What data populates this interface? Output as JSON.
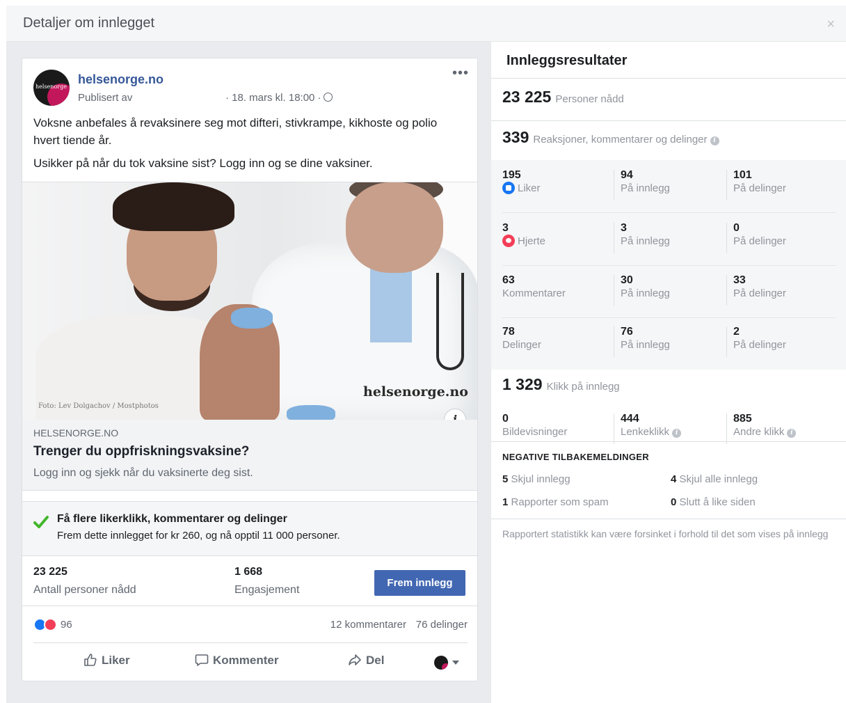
{
  "dialog": {
    "title": "Detaljer om innlegget",
    "close": "×"
  },
  "post": {
    "page_name": "helsenorge.no",
    "avatar_text": "helsenorge",
    "published_by": "Publisert av",
    "date": "· 18. mars kl. 18:00 ·",
    "more": "•••",
    "text_1": "Voksne anbefales å revaksinere seg mot difteri, stivkrampe, kikhoste og polio hvert tiende år.",
    "text_2": "Usikker på når du tok vaksine sist? Logg inn og se dine vaksiner.",
    "image": {
      "credit": "Foto: Lev Dolgachov / Mostphotos",
      "logo": "helsenorge.no",
      "info": "i"
    },
    "link": {
      "domain": "HELSENORGE.NO",
      "title": "Trenger du oppfriskningsvaksine?",
      "description": "Logg inn og sjekk når du vaksinerte deg sist."
    },
    "boost": {
      "title": "Få flere likerklikk, kommentarer og delinger",
      "subtitle": "Frem dette innlegget for kr 260, og nå opptil 11 000 personer."
    },
    "metrics": {
      "reached_value": "23 225",
      "reached_label": "Antall personer nådd",
      "engagement_value": "1 668",
      "engagement_label": "Engasjement",
      "boost_button": "Frem innlegg"
    },
    "reactions": {
      "count": "96",
      "comments": "12 kommentarer",
      "shares": "76 delinger"
    },
    "actions": {
      "like": "Liker",
      "comment": "Kommenter",
      "share": "Del"
    }
  },
  "results": {
    "title": "Innleggsresultater",
    "reach": {
      "value": "23 225",
      "label": "Personer nådd"
    },
    "engagement": {
      "value": "339",
      "label": "Reaksjoner, kommentarer og delinger"
    },
    "rows": [
      {
        "total": "195",
        "label": "Liker",
        "icon": "like-icon",
        "on_post": "94",
        "on_post_label": "På innlegg",
        "on_shares": "101",
        "on_shares_label": "På delinger"
      },
      {
        "total": "3",
        "label": "Hjerte",
        "icon": "heart-icon",
        "on_post": "3",
        "on_post_label": "På innlegg",
        "on_shares": "0",
        "on_shares_label": "På delinger"
      },
      {
        "total": "63",
        "label": "Kommentarer",
        "icon": "",
        "on_post": "30",
        "on_post_label": "På innlegg",
        "on_shares": "33",
        "on_shares_label": "På delinger"
      },
      {
        "total": "78",
        "label": "Delinger",
        "icon": "",
        "on_post": "76",
        "on_post_label": "På innlegg",
        "on_shares": "2",
        "on_shares_label": "På delinger"
      }
    ],
    "clicks": {
      "value": "1 329",
      "label": "Klikk på innlegg",
      "photo_views": "0",
      "photo_views_label": "Bildevisninger",
      "link_clicks": "444",
      "link_clicks_label": "Lenkeklikk",
      "other_clicks": "885",
      "other_clicks_label": "Andre klikk"
    },
    "negative": {
      "title": "NEGATIVE TILBAKEMELDINGER",
      "hide_post": "5",
      "hide_post_label": "Skjul innlegg",
      "hide_all": "4",
      "hide_all_label": "Skjul alle innlegg",
      "spam": "1",
      "spam_label": "Rapporter som spam",
      "unlike": "0",
      "unlike_label": "Slutt å like siden"
    },
    "note": "Rapportert statistikk kan være forsinket i forhold til det som vises på innlegg"
  },
  "colors": {
    "brand_blue": "#4267b2",
    "link_blue": "#365899",
    "like_blue": "#1877f2",
    "heart_red": "#f33e58",
    "check_green": "#42b72a"
  }
}
